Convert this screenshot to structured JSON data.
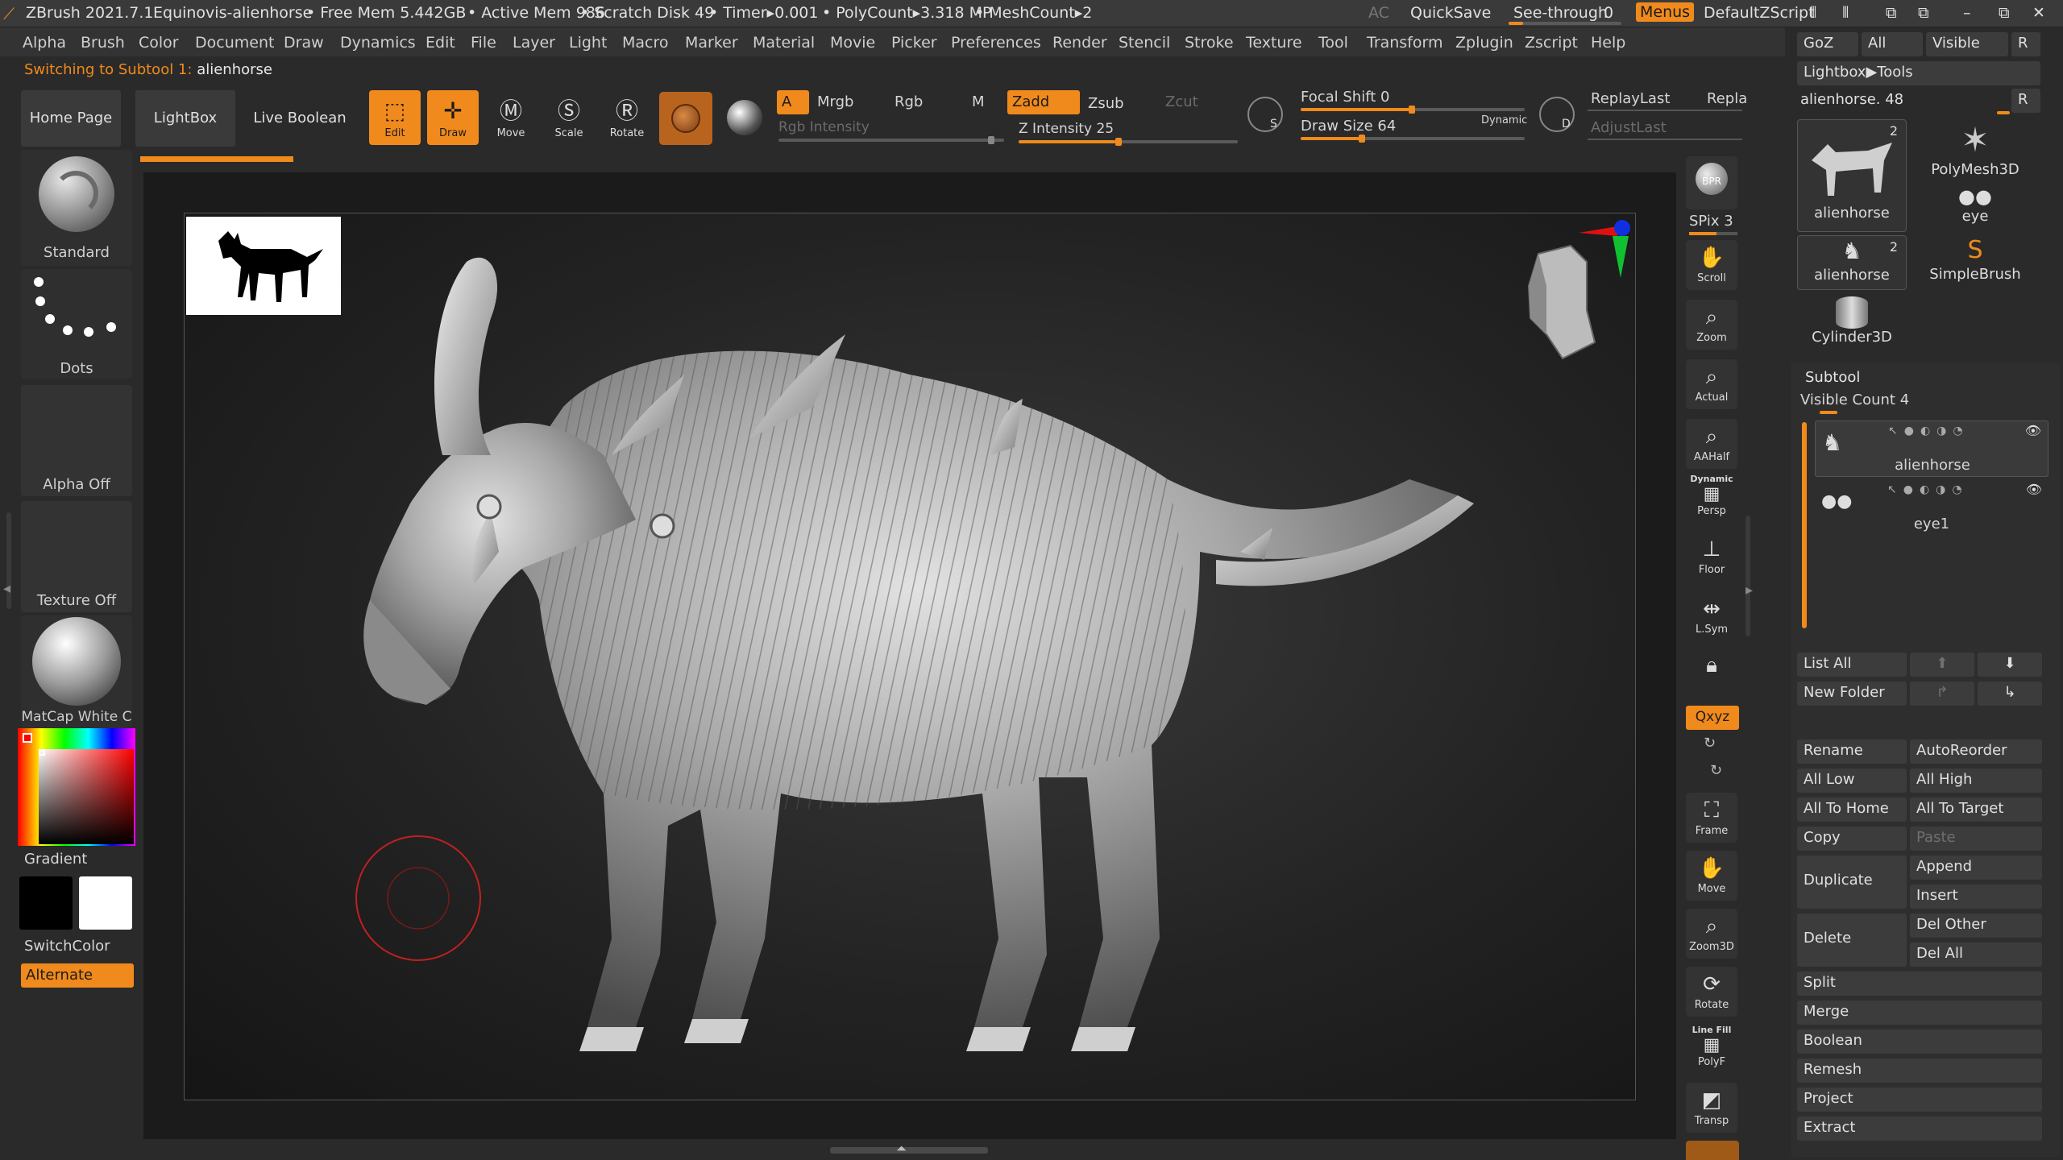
{
  "title_bar": {
    "app": "ZBrush 2021.7.1",
    "doc": "Equinovis-alienhorse",
    "free_mem": "• Free Mem 5.442GB",
    "active_mem": "• Active Mem 986",
    "scratch": "• Scratch Disk 49",
    "timer": "• Timer▸0.001",
    "polycount": "• PolyCount▸3.318 MP",
    "meshcount": "• MeshCount▸2",
    "ac": "AC",
    "quicksave": "QuickSave",
    "see_through": "See-through",
    "see_through_value": "0",
    "menus": "Menus",
    "script": "DefaultZScript"
  },
  "menubar": [
    "Alpha",
    "Brush",
    "Color",
    "Document",
    "Draw",
    "Dynamics",
    "Edit",
    "File",
    "Layer",
    "Light",
    "Macro",
    "Marker",
    "Material",
    "Movie",
    "Picker",
    "Preferences",
    "Render",
    "Stencil",
    "Stroke",
    "Texture",
    "Tool",
    "Transform",
    "Zplugin",
    "Zscript",
    "Help"
  ],
  "notification": {
    "prefix": "Switching to Subtool 1:",
    "name": "alienhorse"
  },
  "toolbar": {
    "home_page": "Home Page",
    "lightbox": "LightBox",
    "live_boolean": "Live Boolean",
    "edit": "Edit",
    "draw": "Draw",
    "move": "Move",
    "scale": "Scale",
    "rotate": "Rotate",
    "a": "A",
    "mrgb": "Mrgb",
    "rgb": "Rgb",
    "m": "M",
    "zadd": "Zadd",
    "zsub": "Zsub",
    "zcut": "Zcut",
    "rgb_intensity": "Rgb Intensity",
    "z_intensity": "Z Intensity 25",
    "z_intensity_value": 25,
    "focal_shift": "Focal Shift 0",
    "focal_shift_value": 0,
    "draw_size": "Draw Size 64",
    "draw_size_value": 64,
    "dynamic": "Dynamic",
    "replay_last": "ReplayLast",
    "repla": "Repla",
    "adjust_last": "AdjustLast",
    "s_label": "S",
    "d_label": "D"
  },
  "left_shelf": {
    "standard": "Standard",
    "dots": "Dots",
    "alpha_off": "Alpha Off",
    "texture_off": "Texture Off",
    "matcap": "MatCap White C",
    "gradient": "Gradient",
    "switch_color": "SwitchColor",
    "alternate": "Alternate"
  },
  "right_shelf": {
    "bpr": "BPR",
    "spix": "SPix 3",
    "scroll": "Scroll",
    "zoom": "Zoom",
    "actual": "Actual",
    "aahalf": "AAHalf",
    "dynamic": "Dynamic",
    "persp": "Persp",
    "floor": "Floor",
    "lsym": "L.Sym",
    "xyz": "Qxyz",
    "frame": "Frame",
    "move": "Move",
    "zoom3d": "Zoom3D",
    "rotate": "Rotate",
    "line_fill": "Line Fill",
    "polyf": "PolyF",
    "transp": "Transp"
  },
  "right_panel": {
    "goz": "GoZ",
    "all": "All",
    "visible": "Visible",
    "r": "R",
    "lightbox_tools": "Lightbox▶Tools",
    "current_tool": "alienhorse. 48",
    "tools": [
      {
        "name": "alienhorse",
        "badge": "2"
      },
      {
        "name": "PolyMesh3D"
      },
      {
        "name": "eye"
      },
      {
        "name": "alienhorse",
        "badge": "2"
      },
      {
        "name": "SimpleBrush"
      },
      {
        "name": "Cylinder3D"
      }
    ],
    "subtool_header": "Subtool",
    "visible_count": "Visible Count 4",
    "subtools": [
      "alienhorse",
      "eye1"
    ],
    "list_all": "List All",
    "new_folder": "New Folder",
    "rename": "Rename",
    "autoreorder": "AutoReorder",
    "all_low": "All Low",
    "all_high": "All High",
    "all_to_home": "All To Home",
    "all_to_target": "All To Target",
    "copy": "Copy",
    "paste": "Paste",
    "duplicate": "Duplicate",
    "append": "Append",
    "insert": "Insert",
    "delete": "Delete",
    "del_other": "Del Other",
    "del_all": "Del All",
    "split": "Split",
    "merge": "Merge",
    "boolean": "Boolean",
    "remesh": "Remesh",
    "project": "Project",
    "extract": "Extract"
  },
  "colors": {
    "accent": "#f08a1c",
    "bg": "#2a2a2a",
    "brush_circle": "#c02020"
  }
}
